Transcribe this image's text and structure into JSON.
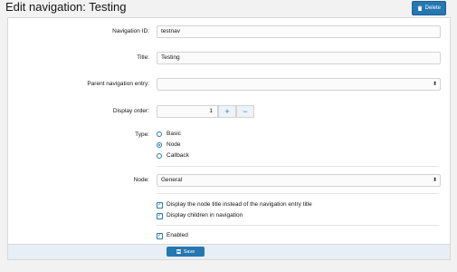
{
  "page": {
    "title": "Edit navigation: Testing"
  },
  "toolbar": {
    "delete_label": "Delete"
  },
  "form": {
    "navigation_id": {
      "label": "Navigation ID:",
      "value": "testnav"
    },
    "title": {
      "label": "Title:",
      "value": "Testing"
    },
    "parent": {
      "label": "Parent navigation entry:",
      "value": ""
    },
    "display_order": {
      "label": "Display order:",
      "value": "1",
      "plus": "+",
      "minus": "−"
    },
    "type": {
      "label": "Type:",
      "options": [
        {
          "label": "Basic",
          "checked": false
        },
        {
          "label": "Node",
          "checked": true
        },
        {
          "label": "Callback",
          "checked": false
        }
      ]
    },
    "node": {
      "label": "Node:",
      "value": "General"
    },
    "checkboxes": [
      {
        "label": "Display the node title instead of the navigation entry title",
        "checked": true
      },
      {
        "label": "Display children in navigation",
        "checked": true
      }
    ],
    "enabled": {
      "label": "Enabled",
      "checked": true
    }
  },
  "footer": {
    "save_label": "Save"
  },
  "colors": {
    "accent": "#2577b1",
    "background": "#f2f2f2",
    "footer": "#e8eef5"
  },
  "icons": {
    "delete": "trash-icon",
    "save": "save-icon",
    "select": "chevron-updown-icon"
  }
}
